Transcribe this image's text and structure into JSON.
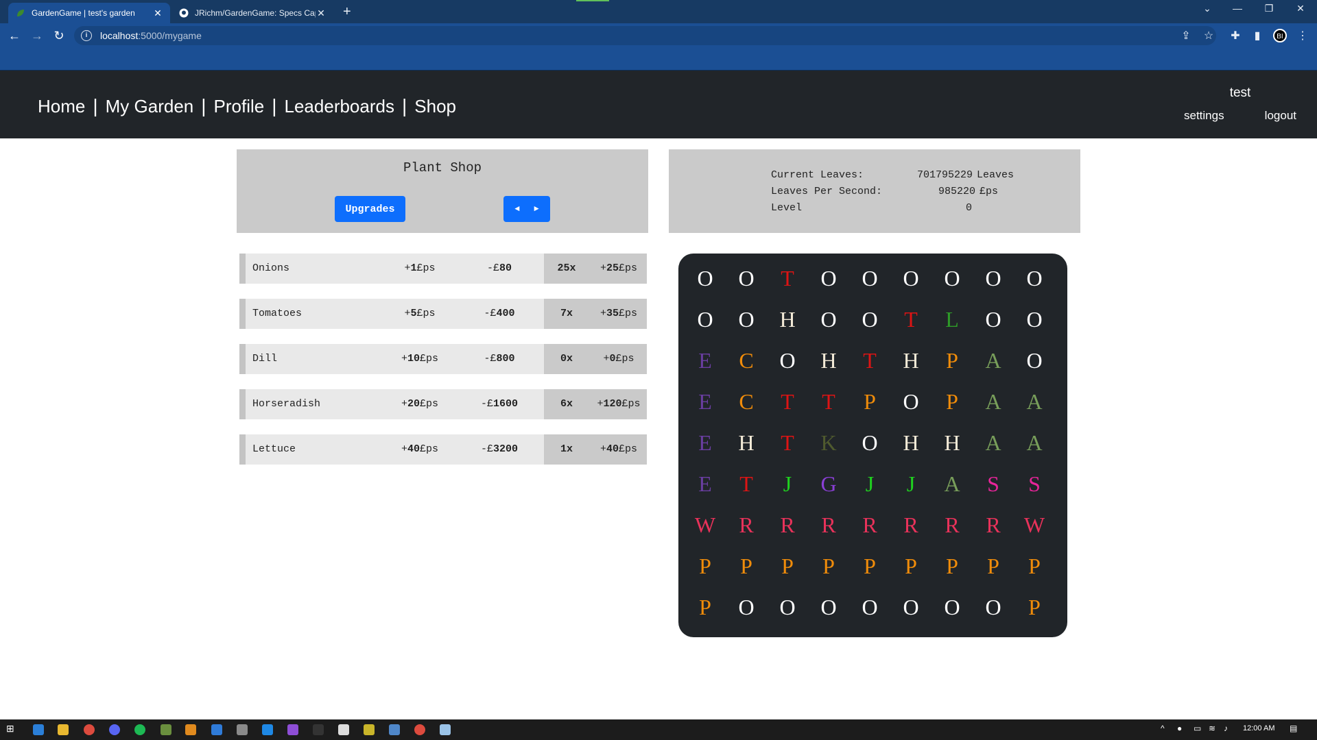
{
  "browser": {
    "tabs": [
      {
        "title": "GardenGame | test's garden",
        "active": true
      },
      {
        "title": "JRichm/GardenGame: Specs Cap",
        "active": false
      }
    ],
    "url_host": "localhost",
    "url_path": ":5000/mygame",
    "profile_initials": "BI"
  },
  "nav": {
    "links": [
      "Home",
      "My Garden",
      "Profile",
      "Leaderboards",
      "Shop"
    ],
    "separator": "|",
    "username": "test",
    "settings": "settings",
    "logout": "logout"
  },
  "shop": {
    "title": "Plant Shop",
    "upgrades_label": "Upgrades",
    "prev_label": "◄",
    "next_label": "►",
    "plants": [
      {
        "name": "Onions",
        "eps_sign": "+",
        "eps_num": "1",
        "eps_unit": "£ps",
        "cost_sign": "-£",
        "cost_num": "80",
        "count_num": "25",
        "count_x": "x",
        "total_sign": "+",
        "total_num": "25",
        "total_unit": "£ps"
      },
      {
        "name": "Tomatoes",
        "eps_sign": "+",
        "eps_num": "5",
        "eps_unit": "£ps",
        "cost_sign": "-£",
        "cost_num": "400",
        "count_num": "7",
        "count_x": "x",
        "total_sign": "+",
        "total_num": "35",
        "total_unit": "£ps"
      },
      {
        "name": "Dill",
        "eps_sign": "+",
        "eps_num": "10",
        "eps_unit": "£ps",
        "cost_sign": "-£",
        "cost_num": "800",
        "count_num": "0",
        "count_x": "x",
        "total_sign": "+",
        "total_num": "0",
        "total_unit": "£ps"
      },
      {
        "name": "Horseradish",
        "eps_sign": "+",
        "eps_num": "20",
        "eps_unit": "£ps",
        "cost_sign": "-£",
        "cost_num": "1600",
        "count_num": "6",
        "count_x": "x",
        "total_sign": "+",
        "total_num": "120",
        "total_unit": "£ps"
      },
      {
        "name": "Lettuce",
        "eps_sign": "+",
        "eps_num": "40",
        "eps_unit": "£ps",
        "cost_sign": "-£",
        "cost_num": "3200",
        "count_num": "1",
        "count_x": "x",
        "total_sign": "+",
        "total_num": "40",
        "total_unit": "£ps"
      }
    ]
  },
  "stats": {
    "current_leaves_label": "Current Leaves:",
    "current_leaves_value": "701795229",
    "current_leaves_unit": "Leaves",
    "lps_label": "Leaves Per Second:",
    "lps_value": "985220",
    "lps_unit": "£ps",
    "level_label": "Level",
    "level_value": "0"
  },
  "garden": {
    "rows": [
      [
        "O",
        "O",
        "T",
        "O",
        "O",
        "O",
        "O",
        "O",
        "O"
      ],
      [
        "O",
        "O",
        "H",
        "O",
        "O",
        "T",
        "L",
        "O",
        "O"
      ],
      [
        "E",
        "C",
        "O",
        "H",
        "T",
        "H",
        "P",
        "A",
        "O"
      ],
      [
        "E",
        "C",
        "T",
        "T",
        "P",
        "O",
        "P",
        "A",
        "A"
      ],
      [
        "E",
        "H",
        "T",
        "K",
        "O",
        "H",
        "H",
        "A",
        "A"
      ],
      [
        "E",
        "T",
        "J",
        "G",
        "J",
        "J",
        "A",
        "S",
        "S"
      ],
      [
        "W",
        "R",
        "R",
        "R",
        "R",
        "R",
        "R",
        "R",
        "W"
      ],
      [
        "P",
        "P",
        "P",
        "P",
        "P",
        "P",
        "P",
        "P",
        "P"
      ],
      [
        "P",
        "O",
        "O",
        "O",
        "O",
        "O",
        "O",
        "O",
        "P"
      ]
    ],
    "colors": {
      "O": "#ffffff",
      "T": "#dc1414",
      "H": "#f3ead7",
      "L": "#2e9c28",
      "E": "#6a3ea1",
      "C": "#f08c0a",
      "P": "#f08c0a",
      "A": "#789e5a",
      "K": "#4f5a2e",
      "J": "#1fd11f",
      "G": "#8a3fd6",
      "S": "#e8249a",
      "W": "#e8325a",
      "R": "#e8325a"
    }
  },
  "taskbar": {
    "time": "12:00 AM"
  }
}
